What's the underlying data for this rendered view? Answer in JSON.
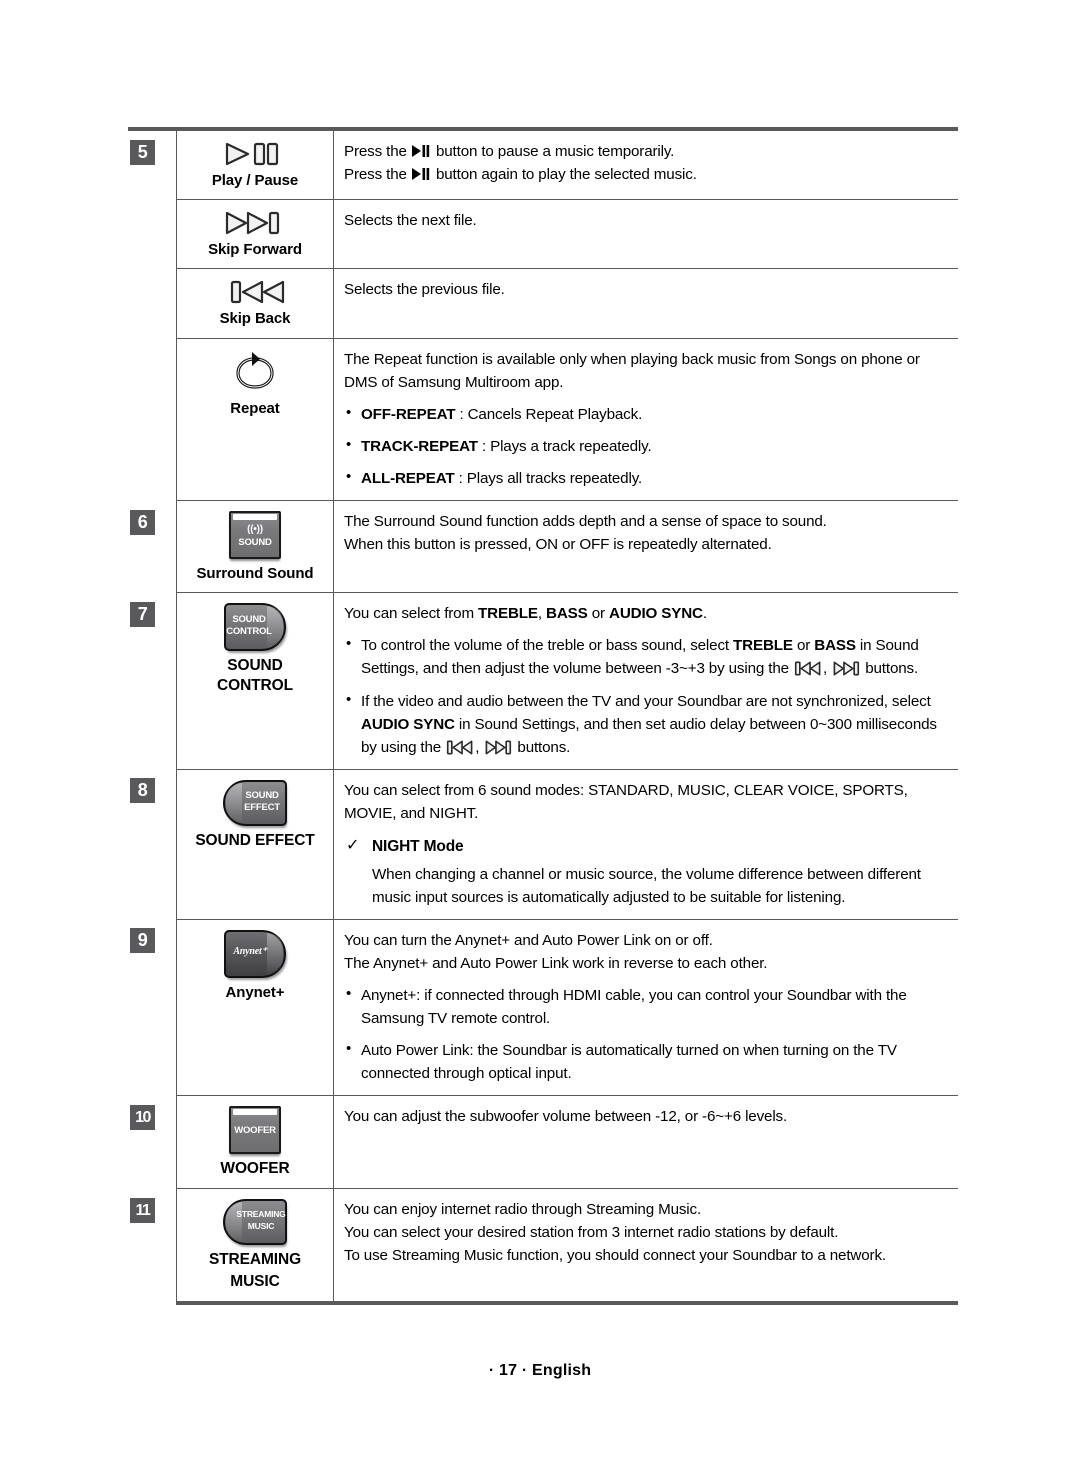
{
  "page": {
    "footer": "· 17 · English"
  },
  "rows": [
    {
      "number": "5",
      "button_icon": "play-pause-icon",
      "button_label": "Play / Pause",
      "lines": [
        "Press the ▶❙❙ button to pause a music temporarily.",
        "Press the ▶❙❙ button again to play the selected music."
      ],
      "line1_pre": "Press the",
      "line1_post": "button to pause a music temporarily.",
      "line2_pre": "Press the",
      "line2_post": "button again to play the selected music."
    },
    {
      "number": "",
      "button_icon": "skip-forward-icon",
      "button_label": "Skip Forward",
      "text": "Selects the next file."
    },
    {
      "number": "",
      "button_icon": "skip-back-icon",
      "button_label": "Skip Back",
      "text": "Selects the previous file."
    },
    {
      "number": "",
      "button_icon": "repeat-icon",
      "button_label": "Repeat",
      "intro": "The Repeat function is available only when playing back music from Songs on phone or DMS of Samsung Multiroom app.",
      "bullets": [
        {
          "bold": "OFF-REPEAT",
          "rest": " : Cancels Repeat Playback."
        },
        {
          "bold": "TRACK-REPEAT",
          "rest": " : Plays a track repeatedly."
        },
        {
          "bold": "ALL-REPEAT",
          "rest": " : Plays all tracks repeatedly."
        }
      ]
    },
    {
      "number": "6",
      "button_icon": "surround-sound-button",
      "button_face_line1": "((•))",
      "button_face_line2": "SOUND",
      "button_label": "Surround Sound",
      "lines": [
        "The Surround Sound function adds depth and a sense of space to sound.",
        "When this button is pressed, ON or OFF is repeatedly alternated."
      ]
    },
    {
      "number": "7",
      "button_icon": "sound-control-button",
      "button_face_line1": "SOUND",
      "button_face_line2": "CONTROL",
      "button_label_line1": "SOUND",
      "button_label_line2": "CONTROL",
      "intro_pre": "You can select from ",
      "intro_b1": "TREBLE",
      "intro_mid1": ", ",
      "intro_b2": "BASS",
      "intro_mid2": " or ",
      "intro_b3": "AUDIO SYNC",
      "intro_post": ".",
      "bullet1": {
        "p1": "To control the volume of the treble or bass sound, select ",
        "b1": "TREBLE",
        "p2": " or ",
        "b2": "BASS",
        "p3": " in Sound Settings, and then adjust the volume between -3~+3 by using the",
        "p4": ", ",
        "p5": " buttons."
      },
      "bullet2": {
        "p1": "If the video and audio between the TV and your Soundbar are not synchronized, select ",
        "b1": "AUDIO SYNC",
        "p2": " in Sound Settings, and then set audio delay between 0~300 milliseconds by using the",
        "p3": ", ",
        "p4": " buttons."
      }
    },
    {
      "number": "8",
      "button_icon": "sound-effect-button",
      "button_face_line1": "SOUND",
      "button_face_line2": "EFFECT",
      "button_label": "SOUND EFFECT",
      "intro": "You can select from 6 sound modes: STANDARD, MUSIC, CLEAR VOICE, SPORTS, MOVIE, and NIGHT.",
      "check_label": "NIGHT Mode",
      "check_body": "When changing a channel or music source, the volume difference between different music input sources is automatically adjusted to be suitable for listening."
    },
    {
      "number": "9",
      "button_icon": "anynet-button",
      "button_face_text": "Anynet⁺",
      "button_label": "Anynet+",
      "lines": [
        "You can turn the Anynet+ and Auto Power Link on or off.",
        "The Anynet+ and Auto Power Link work in reverse to each other."
      ],
      "bullets": [
        "Anynet+: if connected through HDMI cable, you can control your Soundbar with the Samsung TV remote control.",
        "Auto Power Link: the Soundbar is automatically turned on when turning on the TV connected through optical input."
      ]
    },
    {
      "number": "10",
      "button_icon": "woofer-button",
      "button_face_text": "WOOFER",
      "button_label": "WOOFER",
      "text": "You can adjust the subwoofer volume between -12, or -6~+6 levels."
    },
    {
      "number": "11",
      "button_icon": "streaming-music-button",
      "button_face_line1": "STREAMING",
      "button_face_line2": "MUSIC",
      "button_label_line1": "STREAMING",
      "button_label_line2": "MUSIC",
      "lines": [
        "You can enjoy internet radio through Streaming Music.",
        "You can select your desired station from 3 internet radio stations by default.",
        "To use Streaming Music function, you should connect your Soundbar to a network."
      ]
    }
  ],
  "colors": {
    "badge_bg": "#59595b",
    "rule": "#59595b",
    "text": "#000000"
  }
}
